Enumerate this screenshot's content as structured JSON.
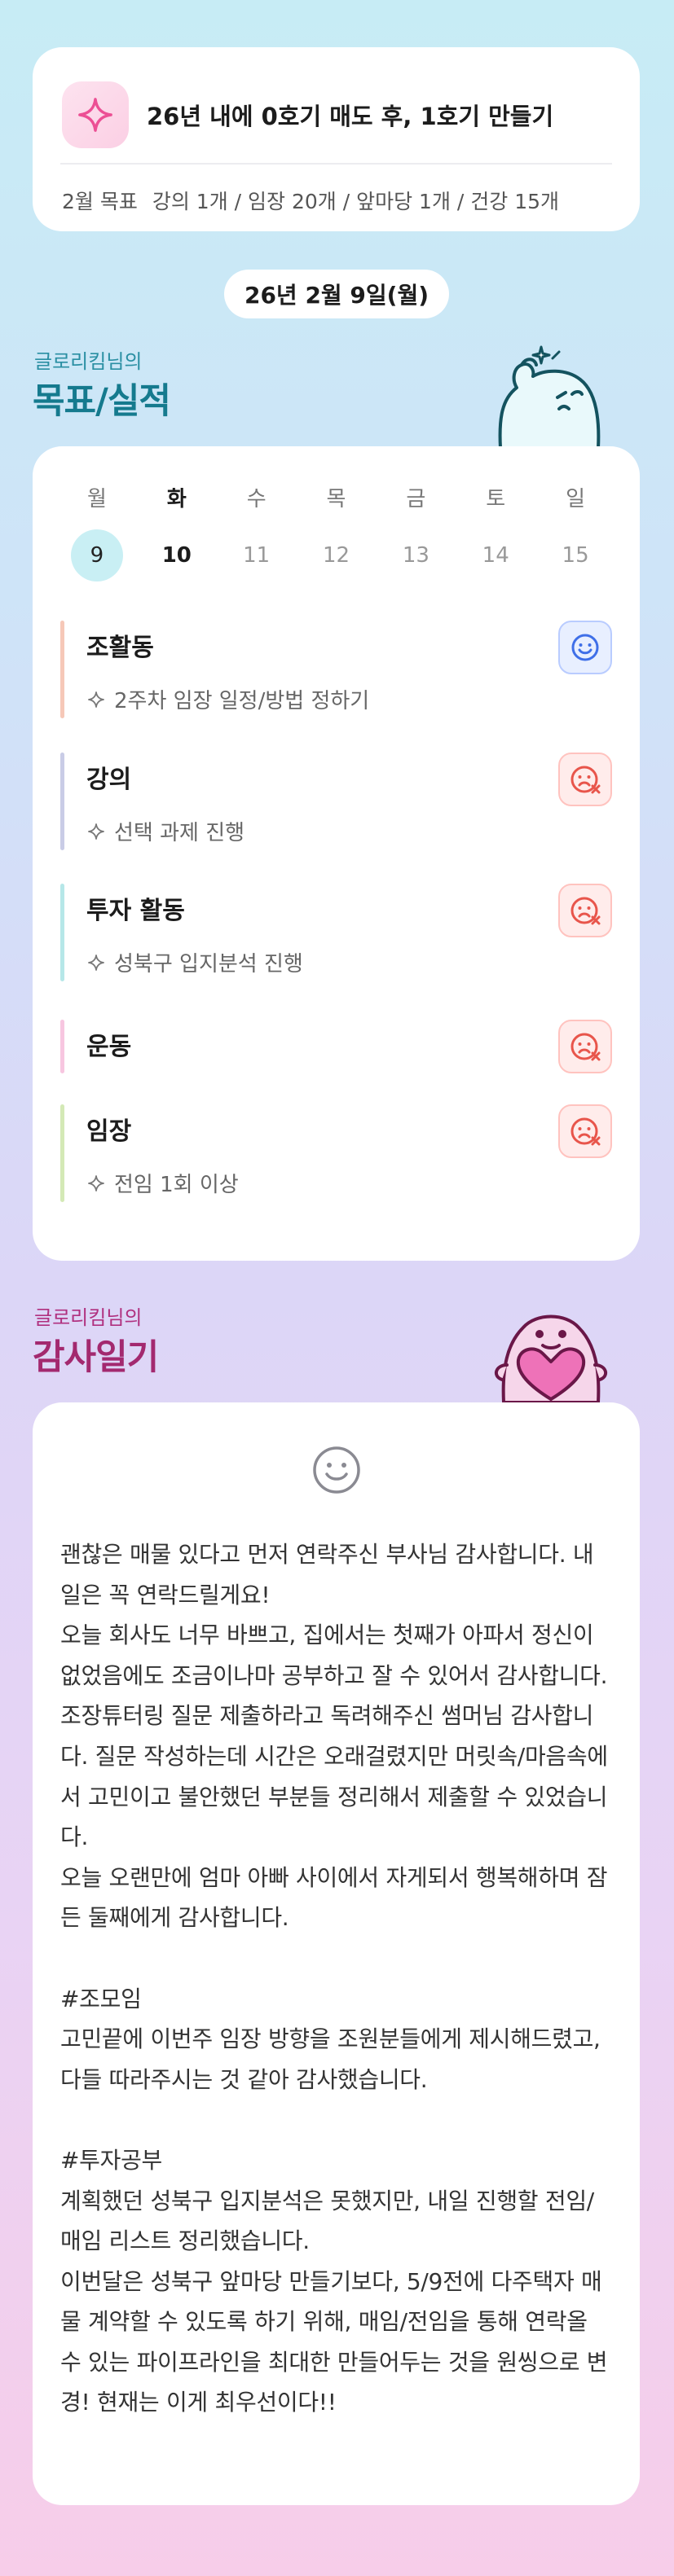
{
  "goal": {
    "icon": "sparkle-icon",
    "title": "26년 내에 0호기 매도 후, 1호기 만들기",
    "month_label": "2월 목표",
    "targets": "강의 1개 / 임장 20개 / 앞마당 1개 / 건강 15개"
  },
  "date_pill": "26년 2월 9일(월)",
  "performance": {
    "owner": "글로리킴님의",
    "title": "목표/실적",
    "weekdays": [
      "월",
      "화",
      "수",
      "목",
      "금",
      "토",
      "일"
    ],
    "days": [
      "9",
      "10",
      "11",
      "12",
      "13",
      "14",
      "15"
    ],
    "tasks": [
      {
        "name": "조활동",
        "detail": "2주차 임장 일정/방법 정하기",
        "status": "good",
        "color": "#f6c8b8"
      },
      {
        "name": "강의",
        "detail": "선택 과제 진행",
        "status": "bad",
        "color": "#c9cce6"
      },
      {
        "name": "투자 활동",
        "detail": "성북구 입지분석 진행",
        "status": "bad",
        "color": "#b6e7e8"
      },
      {
        "name": "운동",
        "detail": "",
        "status": "bad",
        "color": "#f7c6e0"
      },
      {
        "name": "임장",
        "detail": "전임 1회 이상",
        "status": "bad",
        "color": "#d4e9b6"
      }
    ]
  },
  "gratitude": {
    "owner": "글로리킴님의",
    "title": "감사일기",
    "icon": "smile-icon",
    "body": "괜찮은 매물 있다고 먼저 연락주신 부사님 감사합니다. 내일은 꼭 연락드릴게요!\n오늘 회사도 너무 바쁘고, 집에서는 첫째가 아파서 정신이 없었음에도 조금이나마 공부하고 잘 수 있어서 감사합니다.\n조장튜터링 질문 제출하라고 독려해주신 썸머님 감사합니다. 질문 작성하는데 시간은 오래걸렸지만 머릿속/마음속에서 고민이고 불안했던 부분들 정리해서 제출할 수 있었습니다.\n오늘 오랜만에 엄마 아빠 사이에서 자게되서 행복해하며 잠든 둘째에게 감사합니다.\n\n#조모임\n고민끝에 이번주 임장 방향을 조원분들에게 제시해드렸고, 다들 따라주시는 것 같아 감사했습니다.\n\n#투자공부\n계획했던 성북구 입지분석은 못했지만, 내일 진행할 전임/매임 리스트 정리했습니다.\n이번달은 성북구 앞마당 만들기보다, 5/9전에 다주택자 매물 계약할 수 있도록 하기 위해, 매임/전임을 통해 연락올 수 있는 파이프라인을 최대한 만들어두는 것을 원씽으로 변경! 현재는 이게 최우선이다!!"
  }
}
